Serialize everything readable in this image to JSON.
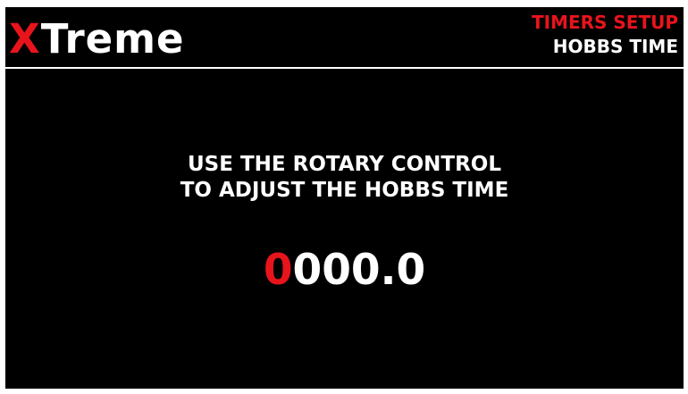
{
  "header": {
    "brand_prefix": "X",
    "brand_suffix": "Treme",
    "menu_title": "TIMERS SETUP",
    "page_title": "HOBBS TIME"
  },
  "main": {
    "instruction_line1": "USE THE ROTARY CONTROL",
    "instruction_line2": "TO ADJUST THE HOBBS TIME",
    "hobbs_value_active_digit": "0",
    "hobbs_value_rest": "000.0"
  },
  "colors": {
    "background": "#000000",
    "text": "#ffffff",
    "accent": "#e8141c"
  }
}
